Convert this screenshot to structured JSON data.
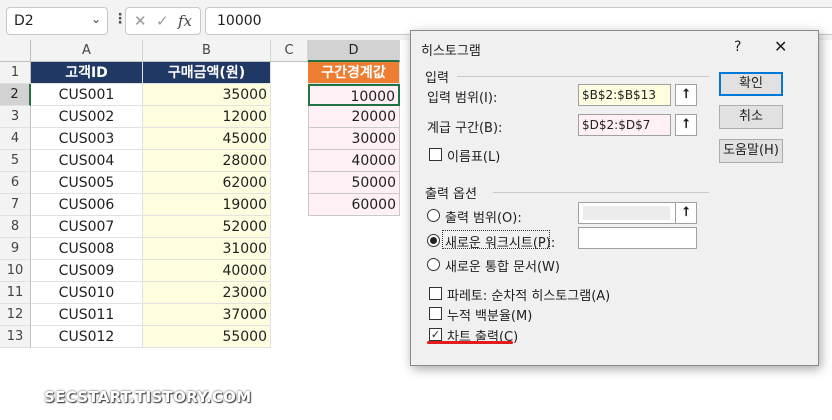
{
  "formula_bar": {
    "name_box": "D2",
    "cancel_icon": "✕",
    "enter_icon": "✓",
    "fx_label": "fx",
    "formula": "10000"
  },
  "sheet": {
    "columns": [
      "A",
      "B",
      "C",
      "D"
    ],
    "rows": [
      "1",
      "2",
      "3",
      "4",
      "5",
      "6",
      "7",
      "8",
      "9",
      "10",
      "11",
      "12",
      "13"
    ],
    "header_customer": "고객ID",
    "header_amount": "구매금액(원)",
    "header_bins": "구간경계값",
    "customers": [
      "CUS001",
      "CUS002",
      "CUS003",
      "CUS004",
      "CUS005",
      "CUS006",
      "CUS007",
      "CUS008",
      "CUS009",
      "CUS010",
      "CUS011",
      "CUS012"
    ],
    "amounts": [
      "35000",
      "12000",
      "45000",
      "28000",
      "62000",
      "19000",
      "52000",
      "31000",
      "40000",
      "23000",
      "37000",
      "55000"
    ],
    "bins": [
      "10000",
      "20000",
      "30000",
      "40000",
      "50000",
      "60000"
    ],
    "colors": {
      "header_navy": "#1f3864",
      "header_orange": "#ed7d31",
      "amount_fill": "#fffde0",
      "bin_fill": "#fff0f5",
      "selection": "#217346"
    }
  },
  "dialog": {
    "title": "히스토그램",
    "help": "?",
    "close": "✕",
    "input_group": "입력",
    "input_range_label": "입력 범위(I):",
    "input_range_value": "$B$2:$B$13",
    "bin_range_label": "계급 구간(B):",
    "bin_range_value": "$D$2:$D$7",
    "labels_label": "이름표(L)",
    "output_group": "출력 옵션",
    "output_range_label": "출력 범위(O):",
    "new_worksheet_label": "새로운 워크시트(P):",
    "new_workbook_label": "새로운 통합 문서(W)",
    "pareto_label": "파레토: 순차적 히스토그램(A)",
    "cumulative_label": "누적 백분율(M)",
    "chart_output_label": "차트 출력(C)",
    "ok_label": "확인",
    "cancel_label": "취소",
    "help_button_label": "도움말(H)",
    "collapse_icon": "⭡"
  },
  "watermark": "SECSTART.TISTORY.COM"
}
